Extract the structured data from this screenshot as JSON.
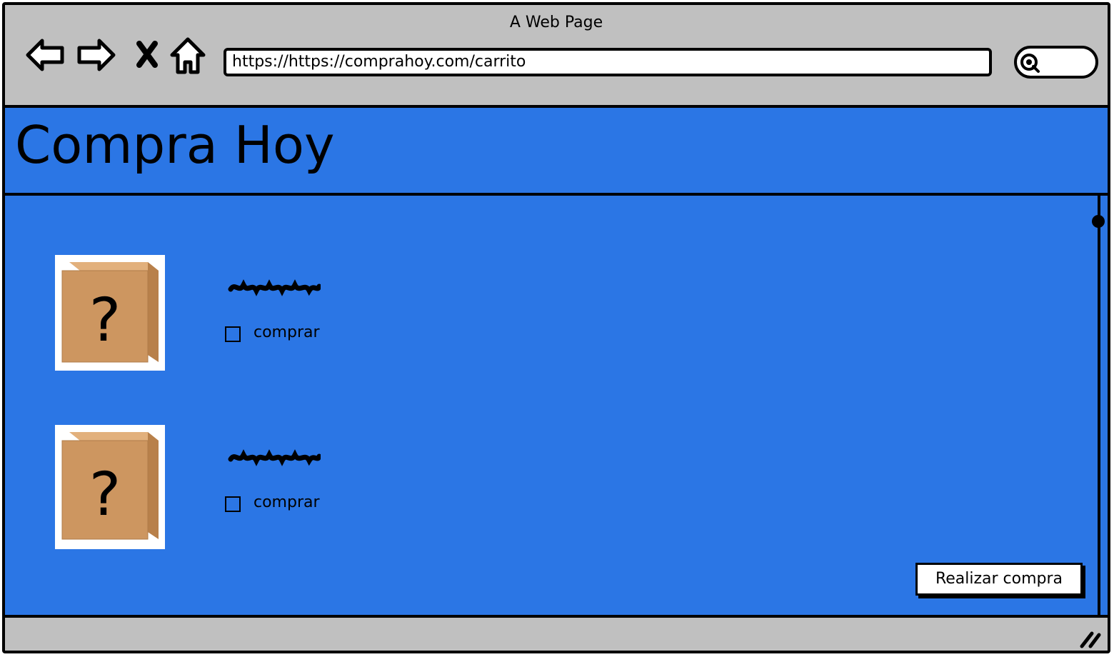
{
  "browser": {
    "window_title": "A Web Page",
    "url": "https://https://comprahoy.com/carrito",
    "search_placeholder": "",
    "icons": [
      "back-arrow-icon",
      "forward-arrow-icon",
      "close-x-icon",
      "home-icon",
      "search-icon",
      "resize-grip-icon"
    ]
  },
  "page": {
    "site_title": "Compra Hoy",
    "background_color": "#2b76e5",
    "products": [
      {
        "image": "box-question-icon",
        "name_placeholder": "scribble",
        "checkbox_label": "comprar",
        "checked": false
      },
      {
        "image": "box-question-icon",
        "name_placeholder": "scribble",
        "checkbox_label": "comprar",
        "checked": false
      }
    ],
    "purchase_button_label": "Realizar compra"
  }
}
